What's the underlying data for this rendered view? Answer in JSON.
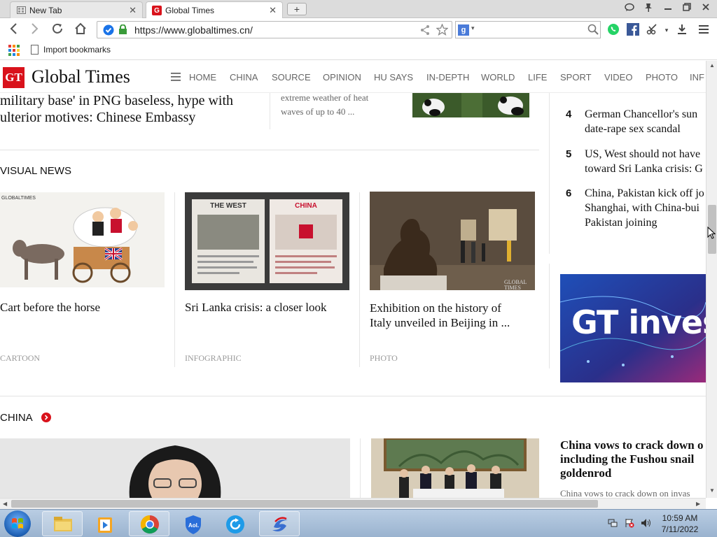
{
  "browser": {
    "tabs": [
      {
        "label": "New Tab",
        "active": false
      },
      {
        "label": "Global Times",
        "active": true
      }
    ],
    "url": "https://www.globaltimes.cn/",
    "search_engine_badge": "g",
    "bookmarks": [
      {
        "label": "Import bookmarks"
      }
    ]
  },
  "site": {
    "logo_mark": "GT",
    "logo_text": "Global Times",
    "nav": [
      "HOME",
      "CHINA",
      "SOURCE",
      "OPINION",
      "HU SAYS",
      "IN-DEPTH",
      "WORLD",
      "LIFE",
      "SPORT",
      "VIDEO",
      "PHOTO",
      "INF"
    ]
  },
  "top_story": {
    "line1": "military base' in PNG baseless, hype with",
    "line2": "ulterior motives: Chinese Embassy",
    "side_line1": "extreme weather of heat",
    "side_line2": "waves of up to 40 ..."
  },
  "trending": [
    {
      "rank": "4",
      "line1": "German Chancellor's sun",
      "line2": "date-rape sex scandal"
    },
    {
      "rank": "5",
      "line1": "US, West should not have",
      "line2": "toward Sri Lanka crisis: G"
    },
    {
      "rank": "6",
      "line1": "China, Pakistan kick off jo",
      "line2": "Shanghai, with China-bui",
      "line3": "Pakistan joining"
    }
  ],
  "visual_news": {
    "heading": "VISUAL NEWS",
    "items": [
      {
        "title": "Cart before the horse",
        "category": "CARTOON"
      },
      {
        "title": "Sri Lanka crisis: a closer look",
        "category": "INFOGRAPHIC",
        "left_label": "THE WEST",
        "right_label": "CHINA"
      },
      {
        "title_line1": "Exhibition on the history of",
        "title_line2": "Italy unveiled in Beijing in ...",
        "category": "PHOTO",
        "watermark": "GLOBAL TIMES"
      }
    ]
  },
  "ad": {
    "text": "GT invest"
  },
  "china_section": {
    "heading": "CHINA",
    "side_headline_line1": "China vows to crack down o",
    "side_headline_line2": "including the Fushou snail",
    "side_headline_line3": "goldenrod",
    "side_snippet": "China vows to crack down on invas"
  },
  "taskbar": {
    "time": "10:59 AM",
    "date": "7/11/2022"
  },
  "colors": {
    "brand_red": "#d9121b",
    "link_text": "#111111",
    "nav_text": "#666666"
  }
}
